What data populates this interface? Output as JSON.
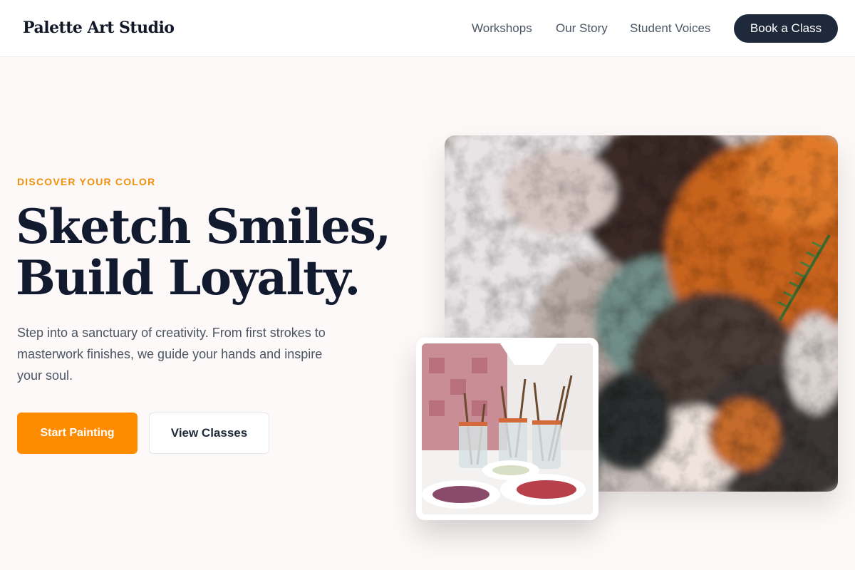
{
  "nav": {
    "brand": "Palette Art Studio",
    "links": [
      "Workshops",
      "Our Story",
      "Student Voices"
    ],
    "cta": "Book a Class"
  },
  "hero": {
    "eyebrow": "DISCOVER YOUR COLOR",
    "headline_line1": "Sketch Smiles,",
    "headline_line2": "Build Loyalty.",
    "lede": "Step into a sanctuary of creativity. From first strokes to masterwork finishes, we guide your hands and inspire your soul.",
    "primary_cta": "Start Painting",
    "secondary_cta": "View Classes"
  },
  "colors": {
    "accent": "#ff8c00",
    "eyebrow": "#f0900a",
    "dark": "#1e293b",
    "background": "#fdf9f8"
  },
  "images": {
    "main": "textured-oil-paint-closeup",
    "inset": "paint-brushes-in-jars"
  }
}
